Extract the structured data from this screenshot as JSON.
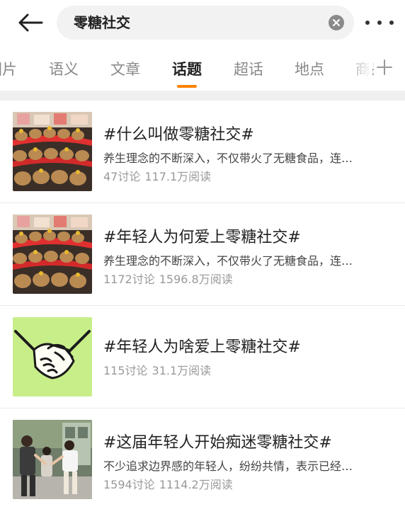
{
  "search": {
    "query": "零糖社交"
  },
  "tabs": [
    {
      "label": "图片"
    },
    {
      "label": "语义"
    },
    {
      "label": "文章"
    },
    {
      "label": "话题",
      "active": true
    },
    {
      "label": "超话"
    },
    {
      "label": "地点"
    },
    {
      "label": "商品"
    }
  ],
  "topics": [
    {
      "title": "#什么叫做零糖社交#",
      "desc": "养生理念的不断深入，不仅带火了无糖食品，连…",
      "discussions": "47讨论",
      "reads": "117.1万阅读",
      "thumb": "capybara-plush-display"
    },
    {
      "title": "#年轻人为何爱上零糖社交#",
      "desc": "养生理念的不断深入，不仅带火了无糖食品，连…",
      "discussions": "1172讨论",
      "reads": "1596.8万阅读",
      "thumb": "capybara-plush-display"
    },
    {
      "title": "#年轻人为啥爱上零糖社交#",
      "desc": "",
      "discussions": "115讨论",
      "reads": "31.1万阅读",
      "thumb": "handshake-illustration"
    },
    {
      "title": "#这届年轻人开始痴迷零糖社交#",
      "desc": "不少追求边界感的年轻人，纷纷共情，表示已经…",
      "discussions": "1594讨论",
      "reads": "1114.2万阅读",
      "thumb": "people-greeting-photo"
    }
  ],
  "colors": {
    "accent": "#ff8200",
    "handshake_bg": "#c8ee8a"
  }
}
